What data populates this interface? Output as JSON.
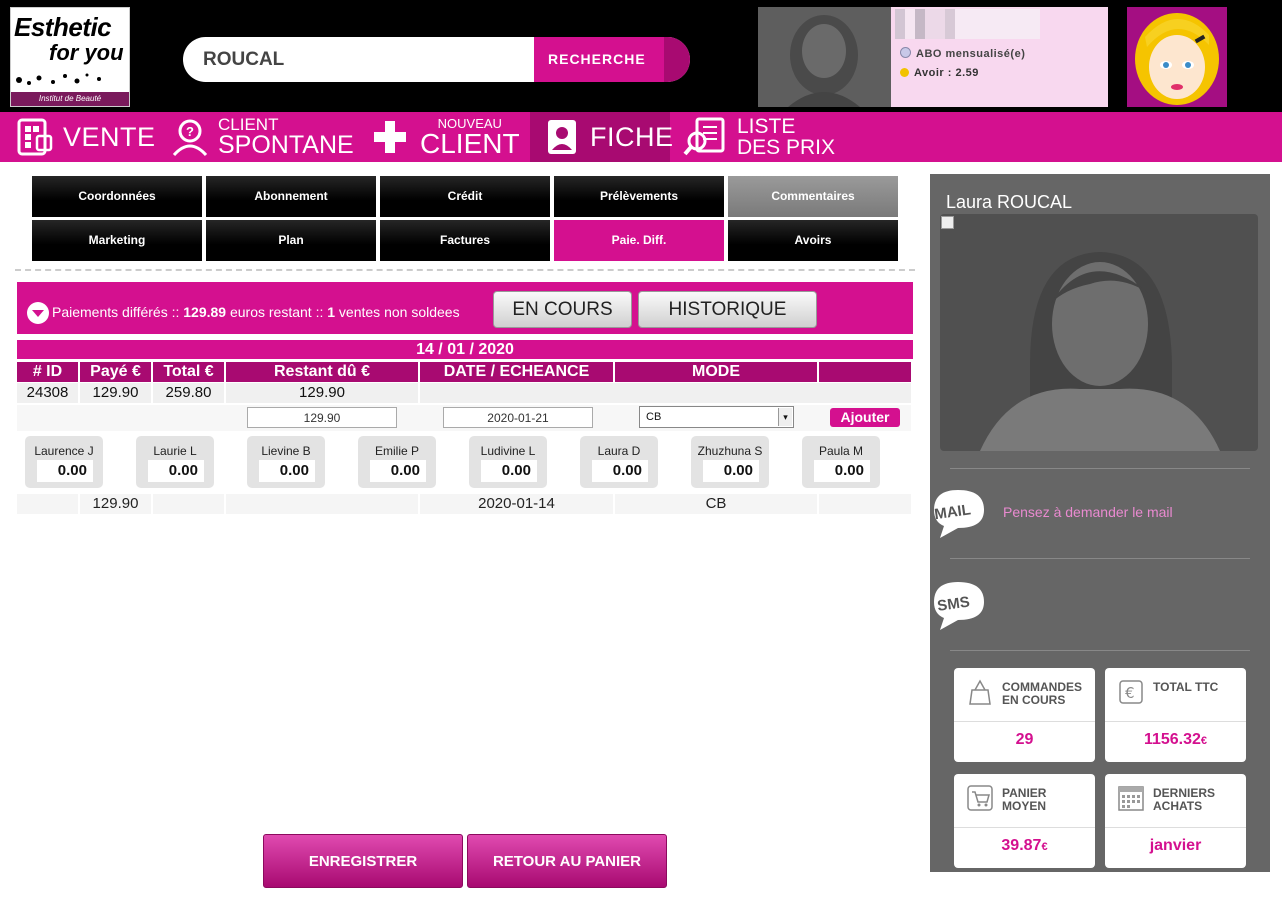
{
  "header": {
    "logo": {
      "line1": "Esthetic",
      "line2": "for you",
      "tagline": "Institut de Beauté"
    },
    "search": {
      "value": "ROUCAL",
      "button": "RECHERCHE"
    },
    "user": {
      "subscription": "ABO mensualisé(e)",
      "credit": "Avoir : 2.59"
    }
  },
  "nav": {
    "vente": "VENTE",
    "spontane_small": "CLIENT",
    "spontane_big": "SPONTANE",
    "nouveau_small": "NOUVEAU",
    "nouveau_big": "CLIENT",
    "fiche": "FICHE",
    "prix_l1": "LISTE",
    "prix_l2": "DES PRIX"
  },
  "tabs": [
    "Coordonnées",
    "Abonnement",
    "Crédit",
    "Prélèvements",
    "Commentaires",
    "Marketing",
    "Plan",
    "Factures",
    "Paie. Diff.",
    "Avoirs"
  ],
  "payments": {
    "prefix": "Paiements différés :: ",
    "remaining": "129.89",
    "middle": " euros restant :: ",
    "unsold": "1",
    "suffix": " ventes non soldees",
    "btn_current": "EN COURS",
    "btn_history": "HISTORIQUE",
    "date": "14 / 01 / 2020",
    "headers": [
      "# ID",
      "Payé €",
      "Total €",
      "Restant dû €",
      "DATE / ECHEANCE",
      "MODE",
      ""
    ],
    "row": {
      "id": "24308",
      "paid": "129.90",
      "total": "259.80",
      "remaining": "129.90"
    },
    "input_amount": "129.90",
    "input_date": "2020-01-21",
    "mode_selected": "CB",
    "add_button": "Ajouter",
    "staff": [
      {
        "name": "Laurence J",
        "value": "0.00"
      },
      {
        "name": "Laurie L",
        "value": "0.00"
      },
      {
        "name": "Lievine B",
        "value": "0.00"
      },
      {
        "name": "Emilie P",
        "value": "0.00"
      },
      {
        "name": "Ludivine L",
        "value": "0.00"
      },
      {
        "name": "Laura D",
        "value": "0.00"
      },
      {
        "name": "Zhuzhuna S",
        "value": "0.00"
      },
      {
        "name": "Paula M",
        "value": "0.00"
      }
    ],
    "history": {
      "paid": "129.90",
      "date": "2020-01-14",
      "mode": "CB"
    }
  },
  "actions": {
    "save": "ENREGISTRER",
    "back": "RETOUR AU PANIER"
  },
  "side": {
    "client_name": "Laura ROUCAL",
    "mail_badge": "MAIL",
    "sms_badge": "SMS",
    "mail_message": "Pensez à demander le mail",
    "stats": {
      "orders_l1": "COMMANDES",
      "orders_l2": "EN COURS",
      "orders_value": "29",
      "total_label": "TOTAL TTC",
      "total_value": "1156.32",
      "total_unit": "€",
      "basket_l1": "PANIER",
      "basket_l2": "MOYEN",
      "basket_value": "39.87",
      "basket_unit": "€",
      "last_l1": "DERNIERS",
      "last_l2": "ACHATS",
      "last_value": "janvier"
    }
  },
  "colors": {
    "primary": "#d4108f",
    "primary_dark": "#a80a71",
    "panel": "#666666"
  }
}
